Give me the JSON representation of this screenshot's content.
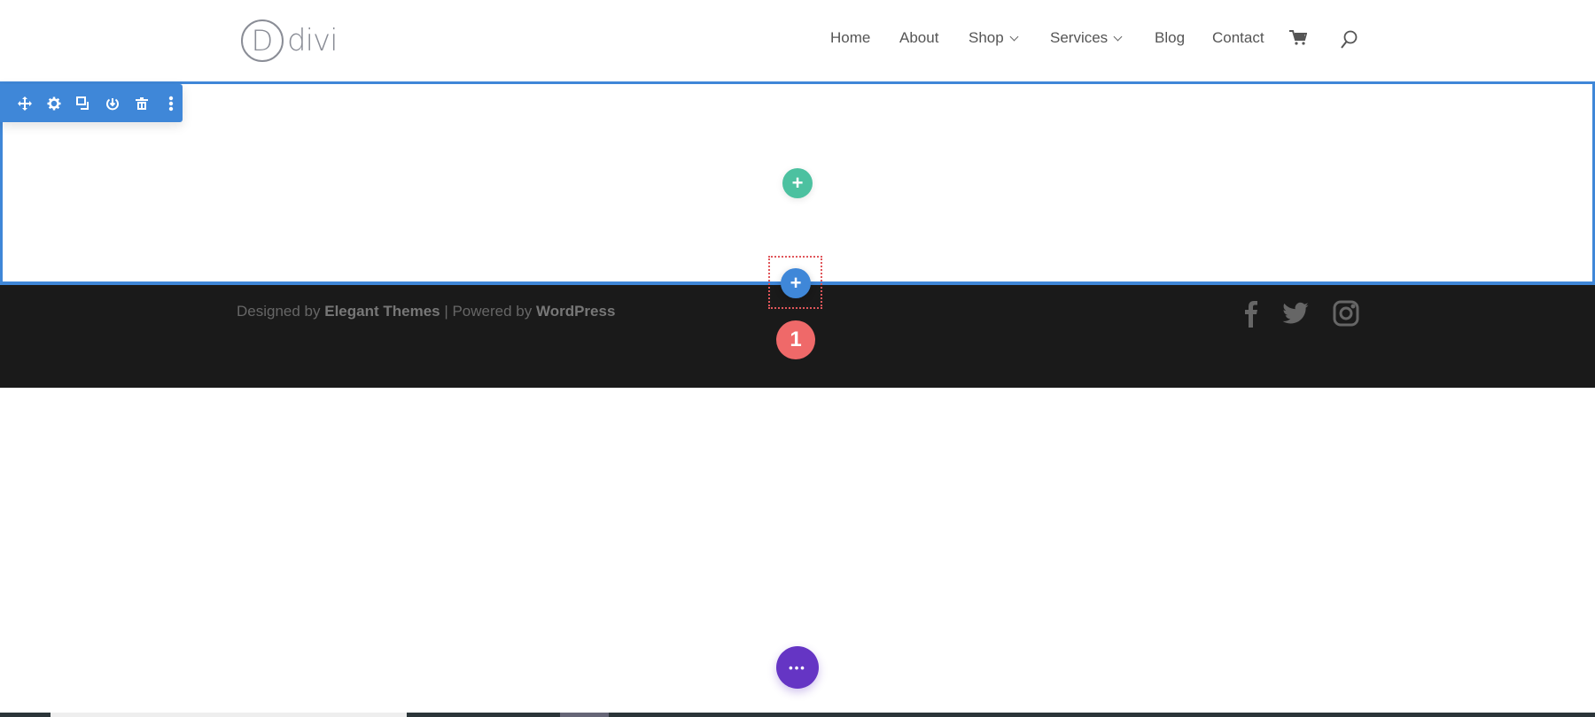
{
  "header": {
    "logo_text": "divi",
    "logo_letter": "D",
    "nav": [
      {
        "label": "Home",
        "has_dropdown": false
      },
      {
        "label": "About",
        "has_dropdown": false
      },
      {
        "label": "Shop",
        "has_dropdown": true
      },
      {
        "label": "Services",
        "has_dropdown": true
      },
      {
        "label": "Blog",
        "has_dropdown": false
      },
      {
        "label": "Contact",
        "has_dropdown": false
      }
    ],
    "icons": [
      "cart-icon",
      "search-icon"
    ]
  },
  "section_toolbar": {
    "icons": [
      "move-icon",
      "settings-icon",
      "duplicate-icon",
      "save-icon",
      "delete-icon",
      "more-icon"
    ],
    "color": "#3f87d8"
  },
  "add_row_button": {
    "label": "+",
    "color": "#4cc1a0"
  },
  "add_section_button": {
    "label": "+",
    "color": "#3f87d8"
  },
  "step_badge": {
    "label": "1",
    "color": "#ef6969"
  },
  "footer": {
    "designed_by": "Designed by ",
    "designer": "Elegant Themes",
    "separator": " | Powered by ",
    "platform": "WordPress",
    "social": [
      "facebook-icon",
      "twitter-icon",
      "instagram-icon"
    ]
  },
  "builder_menu_button": {
    "label": "•••",
    "color": "#6535c4"
  }
}
